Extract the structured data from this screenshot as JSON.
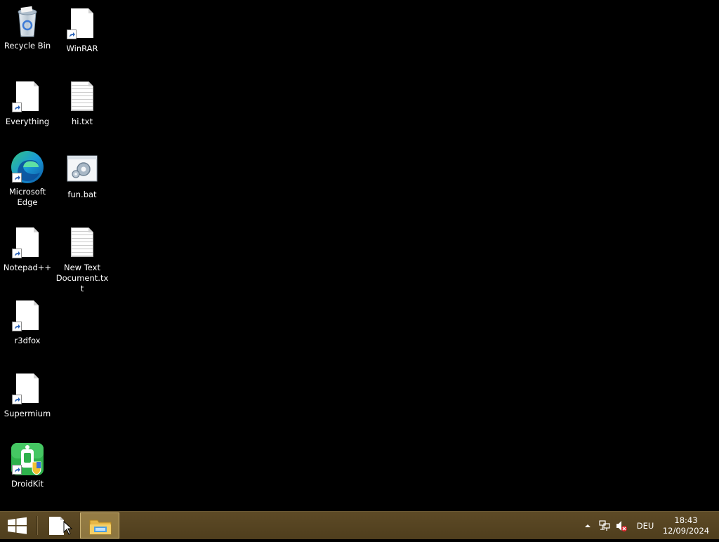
{
  "desktop": {
    "icons": [
      {
        "label": "Recycle Bin",
        "icon": "recycle-bin-icon"
      },
      {
        "label": "WinRAR",
        "icon": "winrar-shortcut-icon"
      },
      {
        "label": "Everything",
        "icon": "everything-shortcut-icon"
      },
      {
        "label": "hi.txt",
        "icon": "text-file-icon"
      },
      {
        "label": "Microsoft Edge",
        "icon": "edge-icon"
      },
      {
        "label": "fun.bat",
        "icon": "batch-file-icon"
      },
      {
        "label": "Notepad++",
        "icon": "notepadpp-shortcut-icon"
      },
      {
        "label": "New Text Document.txt",
        "icon": "text-file-icon"
      },
      {
        "label": "r3dfox",
        "icon": "r3dfox-shortcut-icon"
      },
      {
        "label": "Supermium",
        "icon": "supermium-shortcut-icon"
      },
      {
        "label": "DroidKit",
        "icon": "droidkit-icon"
      }
    ]
  },
  "taskbar": {
    "start_icon": "windows-logo-icon",
    "pinned": [
      {
        "icon": "blank-document-icon",
        "active": false
      },
      {
        "icon": "file-explorer-icon",
        "active": true
      }
    ],
    "tray": {
      "show_hidden_icon": "chevron-up-icon",
      "network_icon": "network-icon",
      "volume_icon": "volume-muted-icon",
      "language": "DEU",
      "time": "18:43",
      "date": "12/09/2024"
    }
  },
  "colors": {
    "taskbar": "#5d4a26",
    "desktop": "#000000"
  }
}
